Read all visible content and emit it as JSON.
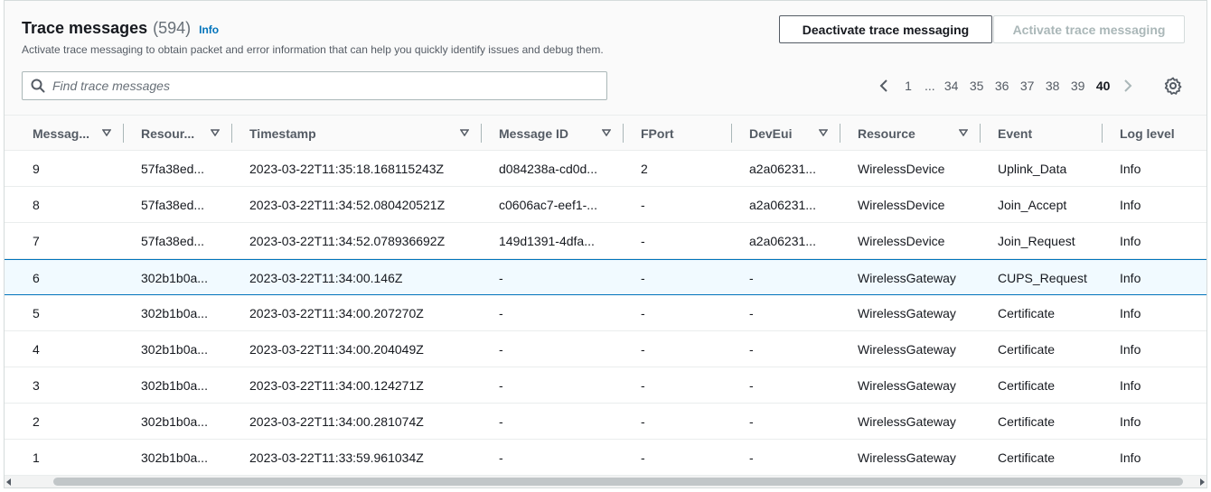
{
  "header": {
    "title": "Trace messages",
    "count": "(594)",
    "info_label": "Info",
    "description": "Activate trace messaging to obtain packet and error information that can help you quickly identify issues and debug them.",
    "deactivate_label": "Deactivate trace messaging",
    "activate_label": "Activate trace messaging"
  },
  "search": {
    "placeholder": "Find trace messages",
    "value": ""
  },
  "pagination": {
    "first": "1",
    "ellipsis": "...",
    "pages": [
      "34",
      "35",
      "36",
      "37",
      "38",
      "39",
      "40"
    ],
    "current": "40"
  },
  "table": {
    "columns": [
      "Messag...",
      "Resour...",
      "Timestamp",
      "Message ID",
      "FPort",
      "DevEui",
      "Resource",
      "Event",
      "Log level"
    ],
    "rows": [
      [
        "9",
        "57fa38ed...",
        "2023-03-22T11:35:18.168115243Z",
        "d084238a-cd0d...",
        "2",
        "a2a06231...",
        "WirelessDevice",
        "Uplink_Data",
        "Info"
      ],
      [
        "8",
        "57fa38ed...",
        "2023-03-22T11:34:52.080420521Z",
        "c0606ac7-eef1-...",
        "-",
        "a2a06231...",
        "WirelessDevice",
        "Join_Accept",
        "Info"
      ],
      [
        "7",
        "57fa38ed...",
        "2023-03-22T11:34:52.078936692Z",
        "149d1391-4dfa...",
        "-",
        "a2a06231...",
        "WirelessDevice",
        "Join_Request",
        "Info"
      ],
      [
        "6",
        "302b1b0a...",
        "2023-03-22T11:34:00.146Z",
        "-",
        "-",
        "-",
        "WirelessGateway",
        "CUPS_Request",
        "Info"
      ],
      [
        "5",
        "302b1b0a...",
        "2023-03-22T11:34:00.207270Z",
        "-",
        "-",
        "-",
        "WirelessGateway",
        "Certificate",
        "Info"
      ],
      [
        "4",
        "302b1b0a...",
        "2023-03-22T11:34:00.204049Z",
        "-",
        "-",
        "-",
        "WirelessGateway",
        "Certificate",
        "Info"
      ],
      [
        "3",
        "302b1b0a...",
        "2023-03-22T11:34:00.124271Z",
        "-",
        "-",
        "-",
        "WirelessGateway",
        "Certificate",
        "Info"
      ],
      [
        "2",
        "302b1b0a...",
        "2023-03-22T11:34:00.281074Z",
        "-",
        "-",
        "-",
        "WirelessGateway",
        "Certificate",
        "Info"
      ],
      [
        "1",
        "302b1b0a...",
        "2023-03-22T11:33:59.961034Z",
        "-",
        "-",
        "-",
        "WirelessGateway",
        "Certificate",
        "Info"
      ]
    ],
    "selected_row_index": 3
  },
  "colors": {
    "accent": "#0073bb",
    "text": "#16191f",
    "muted": "#545b64",
    "border": "#eaeded"
  },
  "icons": {
    "search": "search-icon",
    "prev": "chevron-left-icon",
    "next": "chevron-right-icon",
    "settings": "gear-icon",
    "sort": "sort-caret-down-icon"
  }
}
